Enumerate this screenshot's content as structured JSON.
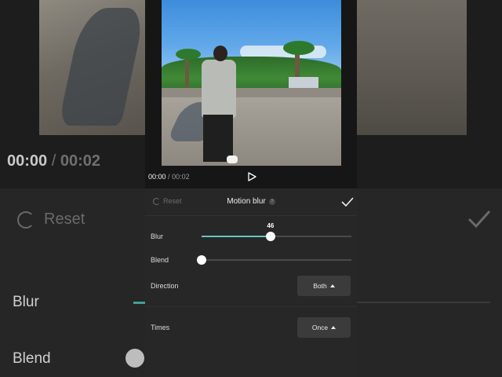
{
  "player": {
    "current_time": "00:00",
    "separator": "/",
    "total_time": "00:02"
  },
  "panel": {
    "reset_label": "Reset",
    "title": "Motion blur",
    "help_glyph": "?",
    "controls": {
      "blur": {
        "label": "Blur",
        "value": 46,
        "value_text": "46",
        "max": 100
      },
      "blend": {
        "label": "Blend",
        "value": 0,
        "max": 100
      },
      "direction": {
        "label": "Direction",
        "selected": "Both"
      },
      "times": {
        "label": "Times",
        "selected": "Once"
      }
    }
  },
  "colors": {
    "accent": "#63c7bd",
    "panel_bg": "#272727",
    "background": "#141414"
  },
  "icons": [
    "reset-icon",
    "help-icon",
    "check-icon",
    "play-icon",
    "caret-up-icon"
  ]
}
